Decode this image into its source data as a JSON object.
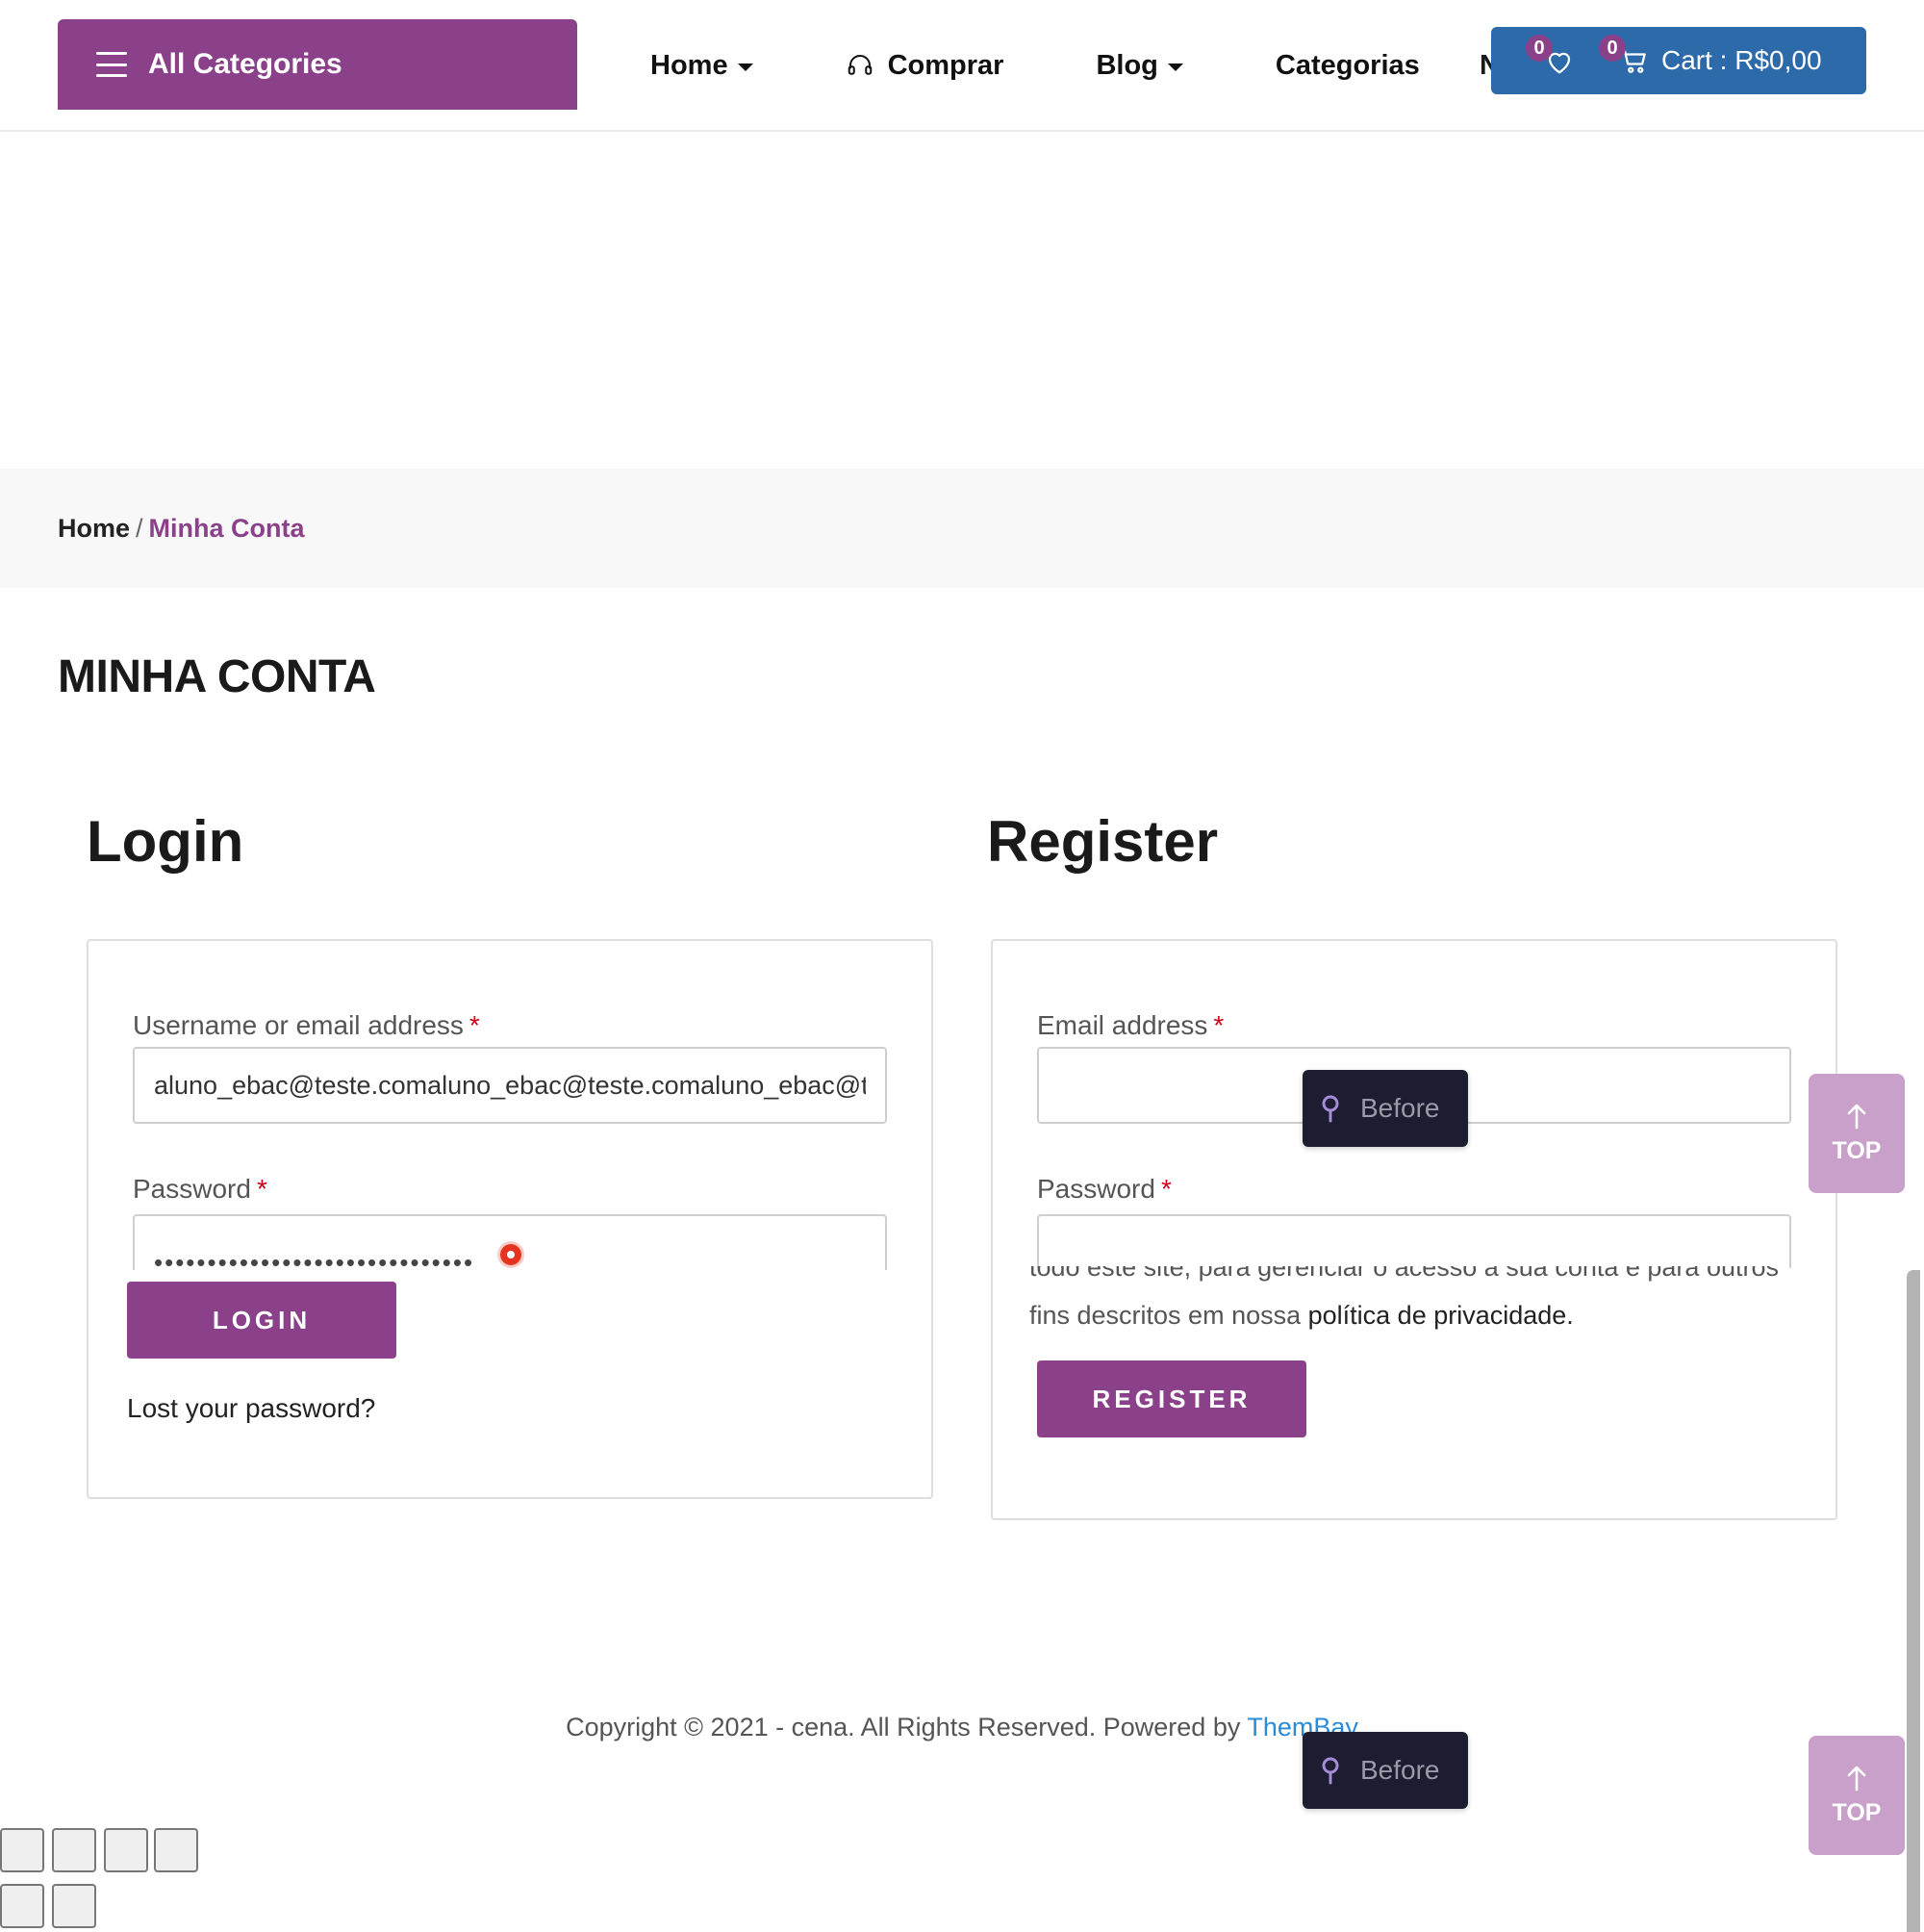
{
  "header": {
    "all_categories": "All Categories",
    "nav": [
      {
        "label": "Home"
      },
      {
        "label": "Comprar"
      },
      {
        "label": "Blog"
      },
      {
        "label": "Categorias"
      }
    ],
    "nav_clipped": "N",
    "wishlist_count": "0",
    "cart_count": "0",
    "cart_label": "Cart : R$0,00"
  },
  "breadcrumb": {
    "home": "Home",
    "separator": "/",
    "current": "Minha Conta"
  },
  "page_title": "MINHA CONTA",
  "login": {
    "title": "Login",
    "username_label": "Username or email address",
    "required_mark": "*",
    "username_value": "aluno_ebac@teste.comaluno_ebac@teste.comaluno_ebac@teste.com",
    "password_label": "Password",
    "password_masked": "••••••••••••••••••••••••••••••",
    "login_button": "LOGIN",
    "lost_password": "Lost your password?"
  },
  "register": {
    "title": "Register",
    "email_label": "Email address",
    "password_label": "Password",
    "privacy_clipped": "todo este site, para gerenciar o acesso à sua conta e para outros",
    "privacy_text": "fins descritos em nossa ",
    "privacy_link": "política de privacidade.",
    "register_button": "REGISTER"
  },
  "tooltip_label": "Before",
  "top_button": "TOP",
  "footer": {
    "copyright": "Copyright © 2021 - cena. All Rights Reserved. Powered by ",
    "link": "ThemBay"
  },
  "colors": {
    "brand_purple": "#8b418a",
    "cart_blue": "#2d6aa9",
    "tooltip_bg": "#1c1d31",
    "top_button": "#c9a0c9",
    "link_blue": "#2a8bd6"
  }
}
